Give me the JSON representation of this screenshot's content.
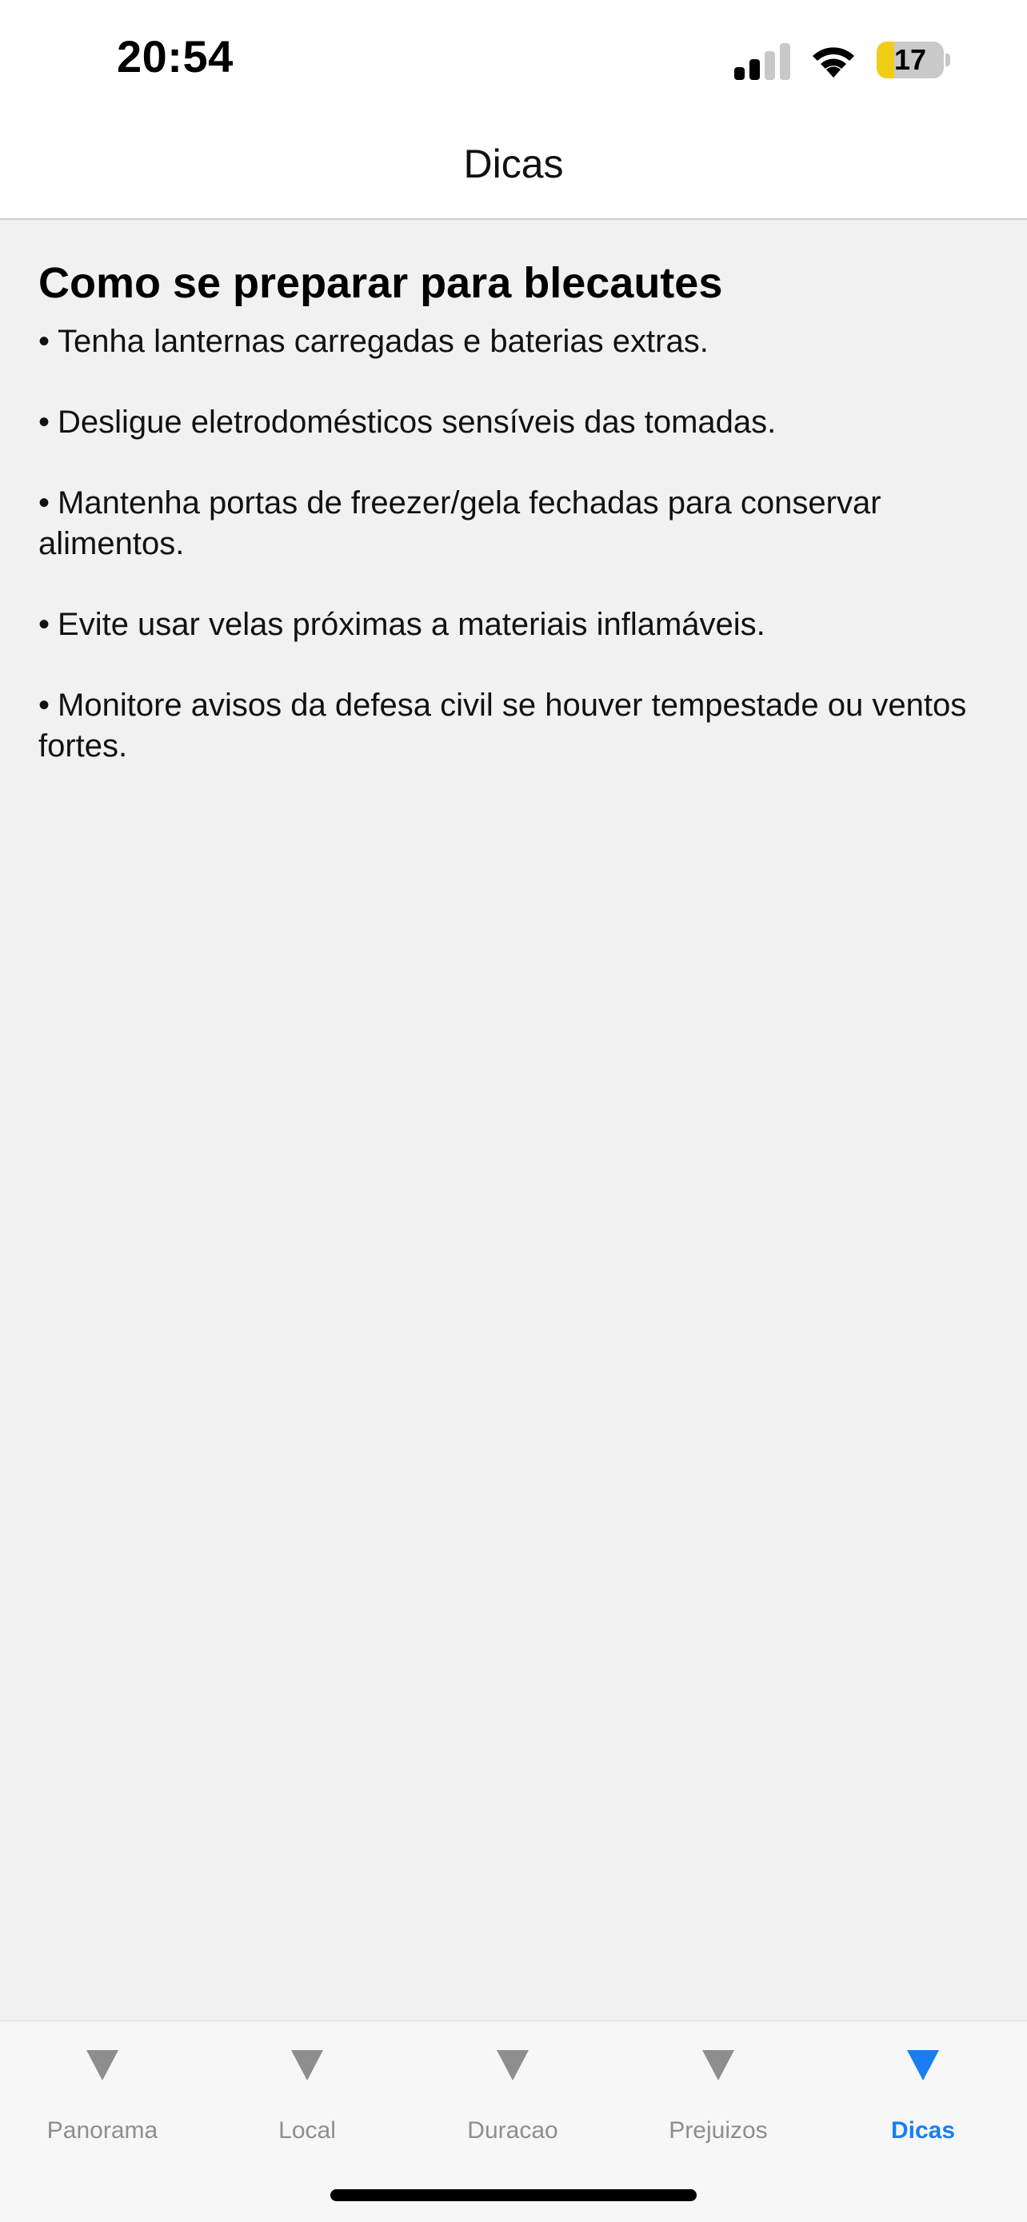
{
  "status_bar": {
    "time": "20:54",
    "battery_level": "17",
    "icons": [
      "cellular-signal-icon",
      "wifi-icon",
      "battery-icon"
    ]
  },
  "nav": {
    "title": "Dicas"
  },
  "section": {
    "title": "Como se preparar para blecautes",
    "tips": [
      "Tenha lanternas carregadas e baterias extras.",
      "Desligue eletrodomésticos sensíveis das tomadas.",
      "Mantenha portas de freezer/gela fechadas para conservar alimentos.",
      "Evite usar velas próximas a materiais inflamáveis.",
      "Monitore avisos da defesa civil se houver tempestade ou ventos fortes."
    ]
  },
  "tab_bar": {
    "tabs": [
      {
        "label": "Panorama",
        "icon": "triangle-down-icon",
        "active": false
      },
      {
        "label": "Local",
        "icon": "triangle-down-icon",
        "active": false
      },
      {
        "label": "Duracao",
        "icon": "triangle-down-icon",
        "active": false
      },
      {
        "label": "Prejuizos",
        "icon": "triangle-down-icon",
        "active": false
      },
      {
        "label": "Dicas",
        "icon": "triangle-down-icon",
        "active": true
      }
    ]
  },
  "colors": {
    "accent": "#1a7ef3",
    "inactive": "#8e8e8e",
    "background": "#f1f1f1",
    "battery_fill": "#f2cd17"
  }
}
